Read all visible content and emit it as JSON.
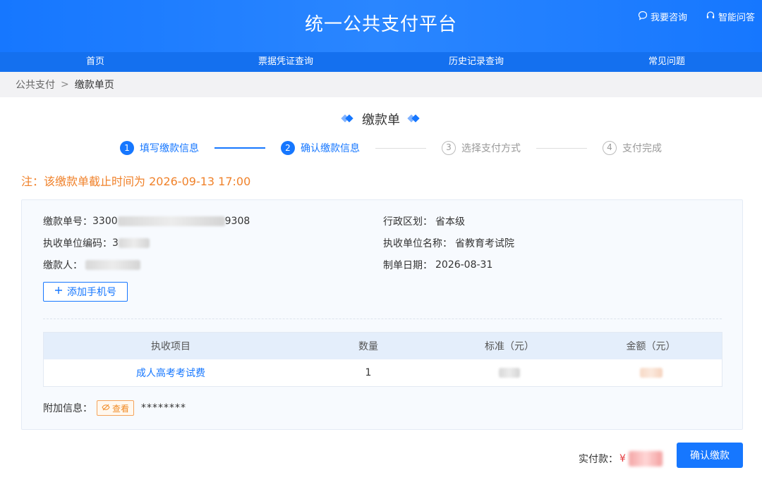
{
  "header": {
    "title": "统一公共支付平台",
    "links": [
      {
        "label": "我要咨询",
        "icon": "chat-icon"
      },
      {
        "label": "智能问答",
        "icon": "headset-icon"
      }
    ]
  },
  "nav": {
    "items": [
      "首页",
      "票据凭证查询",
      "历史记录查询",
      "常见问题"
    ]
  },
  "breadcrumb": {
    "parent": "公共支付",
    "separator": ">",
    "current": "缴款单页"
  },
  "page": {
    "title": "缴款单"
  },
  "steps": [
    {
      "num": "1",
      "label": "填写缴款信息",
      "state": "done"
    },
    {
      "num": "2",
      "label": "确认缴款信息",
      "state": "active"
    },
    {
      "num": "3",
      "label": "选择支付方式",
      "state": "todo"
    },
    {
      "num": "4",
      "label": "支付完成",
      "state": "todo"
    }
  ],
  "notice": "注：该缴款单截止时间为 2026-09-13 17:00",
  "info": {
    "bill_no_label": "缴款单号：",
    "bill_no_prefix": "3300",
    "bill_no_suffix": "9308",
    "region_label": "行政区划：",
    "region_value": "省本级",
    "unit_code_label": "执收单位编码：",
    "unit_code_value": "3",
    "unit_name_label": "执收单位名称：",
    "unit_name_value": "省教育考试院",
    "payer_label": "缴款人：",
    "payer_value": "",
    "date_label": "制单日期：",
    "date_value": "2026-08-31"
  },
  "add_phone_label": "添加手机号",
  "table": {
    "headers": [
      "执收项目",
      "数量",
      "标准（元）",
      "金额（元）"
    ],
    "rows": [
      {
        "item": "成人高考考试费",
        "qty": "1"
      }
    ]
  },
  "extra": {
    "label": "附加信息：",
    "view_label": "查看",
    "masked": "********"
  },
  "footer": {
    "pay_label": "实付款：",
    "currency": "¥",
    "confirm_label": "确认缴款"
  },
  "colors": {
    "brand": "#1677ff",
    "notice": "#f0822b",
    "amount": "#e4393c"
  }
}
